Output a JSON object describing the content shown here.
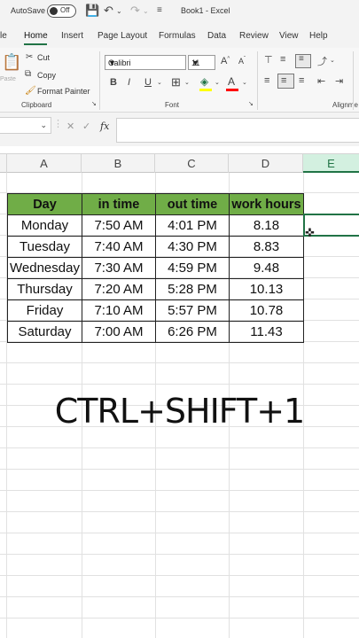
{
  "titlebar": {
    "autosave_label": "AutoSave",
    "autosave_state": "Off",
    "book_title": "Book1 - Excel",
    "save_icon": "save-icon",
    "undo_icon": "undo-icon",
    "redo_icon": "redo-icon",
    "customize_icon": "customize-icon"
  },
  "menu": {
    "tabs": [
      {
        "label": "le"
      },
      {
        "label": "Home"
      },
      {
        "label": "Insert"
      },
      {
        "label": "Page Layout"
      },
      {
        "label": "Formulas"
      },
      {
        "label": "Data"
      },
      {
        "label": "Review"
      },
      {
        "label": "View"
      },
      {
        "label": "Help"
      }
    ],
    "active": "Home",
    "accent_color": "#217346"
  },
  "ribbon": {
    "clipboard": {
      "paste_label": "Paste",
      "cut_label": "Cut",
      "copy_label": "Copy",
      "format_painter_label": "Format Painter",
      "group_label": "Clipboard"
    },
    "font": {
      "font_name": "Calibri",
      "font_size": "11",
      "bold": "B",
      "italic": "I",
      "underline": "U",
      "grow": "A^",
      "shrink": "A^",
      "fill_color_accent": "#ffff00",
      "font_color_accent": "#ff0000",
      "group_label": "Font"
    },
    "alignment": {
      "group_label": "Alignme"
    }
  },
  "formula_bar": {
    "cancel": "✕",
    "enter": "✓",
    "fx": "fx",
    "value": ""
  },
  "columns": [
    "A",
    "B",
    "C",
    "D",
    "E"
  ],
  "selected_column": "E",
  "table": {
    "header_color": "#70ad47",
    "headers": [
      "Day",
      "in time",
      "out time",
      "work hours"
    ],
    "rows": [
      [
        "Monday",
        "7:50 AM",
        "4:01 PM",
        "8.18"
      ],
      [
        "Tuesday",
        "7:40 AM",
        "4:30 PM",
        "8.83"
      ],
      [
        "Wednesday",
        "7:30 AM",
        "4:59 PM",
        "9.48"
      ],
      [
        "Thursday",
        "7:20 AM",
        "5:28 PM",
        "10.13"
      ],
      [
        "Friday",
        "7:10 AM",
        "5:57 PM",
        "10.78"
      ],
      [
        "Saturday",
        "7:00 AM",
        "6:26 PM",
        "11.43"
      ]
    ]
  },
  "caption": "CTRL+SHIFT+1"
}
